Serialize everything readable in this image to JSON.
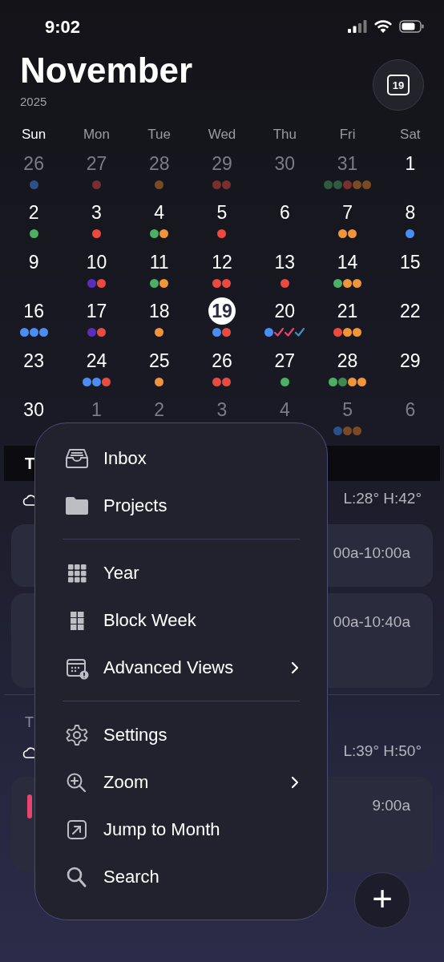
{
  "status_bar": {
    "time": "9:02"
  },
  "header": {
    "month": "November",
    "year": "2025",
    "today_button": "19"
  },
  "weekdays": [
    {
      "label": "Sun",
      "selected": true
    },
    {
      "label": "Mon",
      "selected": false
    },
    {
      "label": "Tue",
      "selected": false
    },
    {
      "label": "Wed",
      "selected": false
    },
    {
      "label": "Thu",
      "selected": false
    },
    {
      "label": "Fri",
      "selected": false
    },
    {
      "label": "Sat",
      "selected": false
    }
  ],
  "days": [
    {
      "day": "26",
      "dim": true,
      "selected": false,
      "marks": [
        {
          "kind": "dot",
          "color": "#2a5288"
        }
      ]
    },
    {
      "day": "27",
      "dim": true,
      "selected": false,
      "marks": [
        {
          "kind": "dot",
          "color": "#7a2e2e"
        }
      ]
    },
    {
      "day": "28",
      "dim": true,
      "selected": false,
      "marks": [
        {
          "kind": "dot",
          "color": "#7a4a25"
        }
      ]
    },
    {
      "day": "29",
      "dim": true,
      "selected": false,
      "marks": [
        {
          "kind": "dot",
          "color": "#7a2e2e"
        },
        {
          "kind": "dot",
          "color": "#7a2e2e"
        }
      ]
    },
    {
      "day": "30",
      "dim": true,
      "selected": false
    },
    {
      "day": "31",
      "dim": true,
      "selected": false,
      "marks": [
        {
          "kind": "dot",
          "color": "#2f5a3e"
        },
        {
          "kind": "dot",
          "color": "#2f5a3e"
        },
        {
          "kind": "dot",
          "color": "#7a2e2e"
        },
        {
          "kind": "dot",
          "color": "#7a4a25"
        },
        {
          "kind": "dot",
          "color": "#7a4a25"
        }
      ]
    },
    {
      "day": "1",
      "dim": false,
      "selected": false
    },
    {
      "day": "2",
      "dim": false,
      "selected": false,
      "marks": [
        {
          "kind": "dot",
          "color": "#4caf63"
        }
      ]
    },
    {
      "day": "3",
      "dim": false,
      "selected": false,
      "marks": [
        {
          "kind": "dot",
          "color": "#ea4a3f"
        }
      ]
    },
    {
      "day": "4",
      "dim": false,
      "selected": false,
      "marks": [
        {
          "kind": "dot",
          "color": "#4caf63"
        },
        {
          "kind": "dot",
          "color": "#f0953a"
        }
      ]
    },
    {
      "day": "5",
      "dim": false,
      "selected": false,
      "marks": [
        {
          "kind": "dot",
          "color": "#ea4a3f"
        }
      ]
    },
    {
      "day": "6",
      "dim": false,
      "selected": false
    },
    {
      "day": "7",
      "dim": false,
      "selected": false,
      "marks": [
        {
          "kind": "dot",
          "color": "#f0953a"
        },
        {
          "kind": "dot",
          "color": "#f0953a"
        }
      ]
    },
    {
      "day": "8",
      "dim": false,
      "selected": false,
      "marks": [
        {
          "kind": "dot",
          "color": "#4a8ef5"
        }
      ]
    },
    {
      "day": "9",
      "dim": false,
      "selected": false
    },
    {
      "day": "10",
      "dim": false,
      "selected": false,
      "marks": [
        {
          "kind": "dot",
          "color": "#5b2dbf"
        },
        {
          "kind": "dot",
          "color": "#ea4a3f"
        }
      ]
    },
    {
      "day": "11",
      "dim": false,
      "selected": false,
      "marks": [
        {
          "kind": "dot",
          "color": "#4caf63"
        },
        {
          "kind": "dot",
          "color": "#f0953a"
        }
      ]
    },
    {
      "day": "12",
      "dim": false,
      "selected": false,
      "marks": [
        {
          "kind": "dot",
          "color": "#ea4a3f"
        },
        {
          "kind": "dot",
          "color": "#ea4a3f"
        }
      ]
    },
    {
      "day": "13",
      "dim": false,
      "selected": false,
      "marks": [
        {
          "kind": "dot",
          "color": "#ea4a3f"
        }
      ]
    },
    {
      "day": "14",
      "dim": false,
      "selected": false,
      "marks": [
        {
          "kind": "dot",
          "color": "#4caf63"
        },
        {
          "kind": "dot",
          "color": "#f0953a"
        },
        {
          "kind": "dot",
          "color": "#f0953a"
        }
      ]
    },
    {
      "day": "15",
      "dim": false,
      "selected": false
    },
    {
      "day": "16",
      "dim": false,
      "selected": false,
      "marks": [
        {
          "kind": "dot",
          "color": "#4a8ef5"
        },
        {
          "kind": "dot",
          "color": "#4a8ef5"
        },
        {
          "kind": "dot",
          "color": "#4a8ef5"
        }
      ]
    },
    {
      "day": "17",
      "dim": false,
      "selected": false,
      "marks": [
        {
          "kind": "dot",
          "color": "#5b2dbf"
        },
        {
          "kind": "dot",
          "color": "#ea4a3f"
        }
      ]
    },
    {
      "day": "18",
      "dim": false,
      "selected": false,
      "marks": [
        {
          "kind": "dot",
          "color": "#f0953a"
        }
      ]
    },
    {
      "day": "19",
      "dim": false,
      "selected": true,
      "marks": [
        {
          "kind": "dot",
          "color": "#4a8ef5"
        },
        {
          "kind": "dot",
          "color": "#ea4a3f"
        }
      ]
    },
    {
      "day": "20",
      "dim": false,
      "selected": false,
      "marks": [
        {
          "kind": "dot",
          "color": "#4a8ef5"
        },
        {
          "kind": "check",
          "color": "#e8456e"
        },
        {
          "kind": "check",
          "color": "#e8456e"
        },
        {
          "kind": "check",
          "color": "#3f8fc4"
        }
      ]
    },
    {
      "day": "21",
      "dim": false,
      "selected": false,
      "marks": [
        {
          "kind": "dot",
          "color": "#ea4a3f"
        },
        {
          "kind": "dot",
          "color": "#f0953a"
        },
        {
          "kind": "dot",
          "color": "#f0953a"
        }
      ]
    },
    {
      "day": "22",
      "dim": false,
      "selected": false
    },
    {
      "day": "23",
      "dim": false,
      "selected": false
    },
    {
      "day": "24",
      "dim": false,
      "selected": false,
      "marks": [
        {
          "kind": "dot",
          "color": "#4a8ef5"
        },
        {
          "kind": "dot",
          "color": "#4a8ef5"
        },
        {
          "kind": "dot",
          "color": "#ea4a3f"
        }
      ]
    },
    {
      "day": "25",
      "dim": false,
      "selected": false,
      "marks": [
        {
          "kind": "dot",
          "color": "#f0953a"
        }
      ]
    },
    {
      "day": "26",
      "dim": false,
      "selected": false,
      "marks": [
        {
          "kind": "dot",
          "color": "#ea4a3f"
        },
        {
          "kind": "dot",
          "color": "#ea4a3f"
        }
      ]
    },
    {
      "day": "27",
      "dim": false,
      "selected": false,
      "marks": [
        {
          "kind": "dot",
          "color": "#4caf63"
        }
      ]
    },
    {
      "day": "28",
      "dim": false,
      "selected": false,
      "marks": [
        {
          "kind": "dot",
          "color": "#4caf63"
        },
        {
          "kind": "dot",
          "color": "#3e8a50"
        },
        {
          "kind": "dot",
          "color": "#f0953a"
        },
        {
          "kind": "dot",
          "color": "#f0953a"
        }
      ]
    },
    {
      "day": "29",
      "dim": false,
      "selected": false
    },
    {
      "day": "30",
      "dim": false,
      "selected": false
    },
    {
      "day": "1",
      "dim": true,
      "selected": false
    },
    {
      "day": "2",
      "dim": true,
      "selected": false
    },
    {
      "day": "3",
      "dim": true,
      "selected": false
    },
    {
      "day": "4",
      "dim": true,
      "selected": false
    },
    {
      "day": "5",
      "dim": true,
      "selected": false,
      "marks": [
        {
          "kind": "dot",
          "color": "#2a5288"
        },
        {
          "kind": "dot",
          "color": "#7a4a25"
        },
        {
          "kind": "dot",
          "color": "#7a4a25"
        }
      ]
    },
    {
      "day": "6",
      "dim": true,
      "selected": false
    }
  ],
  "agenda": [
    {
      "heading": "T",
      "highlighted": true,
      "weather": "L:28° H:42°",
      "events": [
        {
          "time": "00a-10:00a"
        },
        {
          "time": "00a-10:40a"
        }
      ]
    },
    {
      "heading": "T",
      "highlighted": false,
      "weather": "L:39° H:50°",
      "events": [
        {
          "time": "9:00a",
          "color": "#e8456e"
        }
      ]
    }
  ],
  "menu": {
    "groups": [
      [
        {
          "label": "Inbox",
          "submenu": false
        },
        {
          "label": "Projects",
          "submenu": false
        }
      ],
      [
        {
          "label": "Year",
          "submenu": false
        },
        {
          "label": "Block Week",
          "submenu": false
        },
        {
          "label": "Advanced Views",
          "submenu": true
        }
      ],
      [
        {
          "label": "Settings",
          "submenu": false
        },
        {
          "label": "Zoom",
          "submenu": true
        },
        {
          "label": "Jump to Month",
          "submenu": false
        },
        {
          "label": "Search",
          "submenu": false
        }
      ]
    ]
  },
  "add_button": "+"
}
